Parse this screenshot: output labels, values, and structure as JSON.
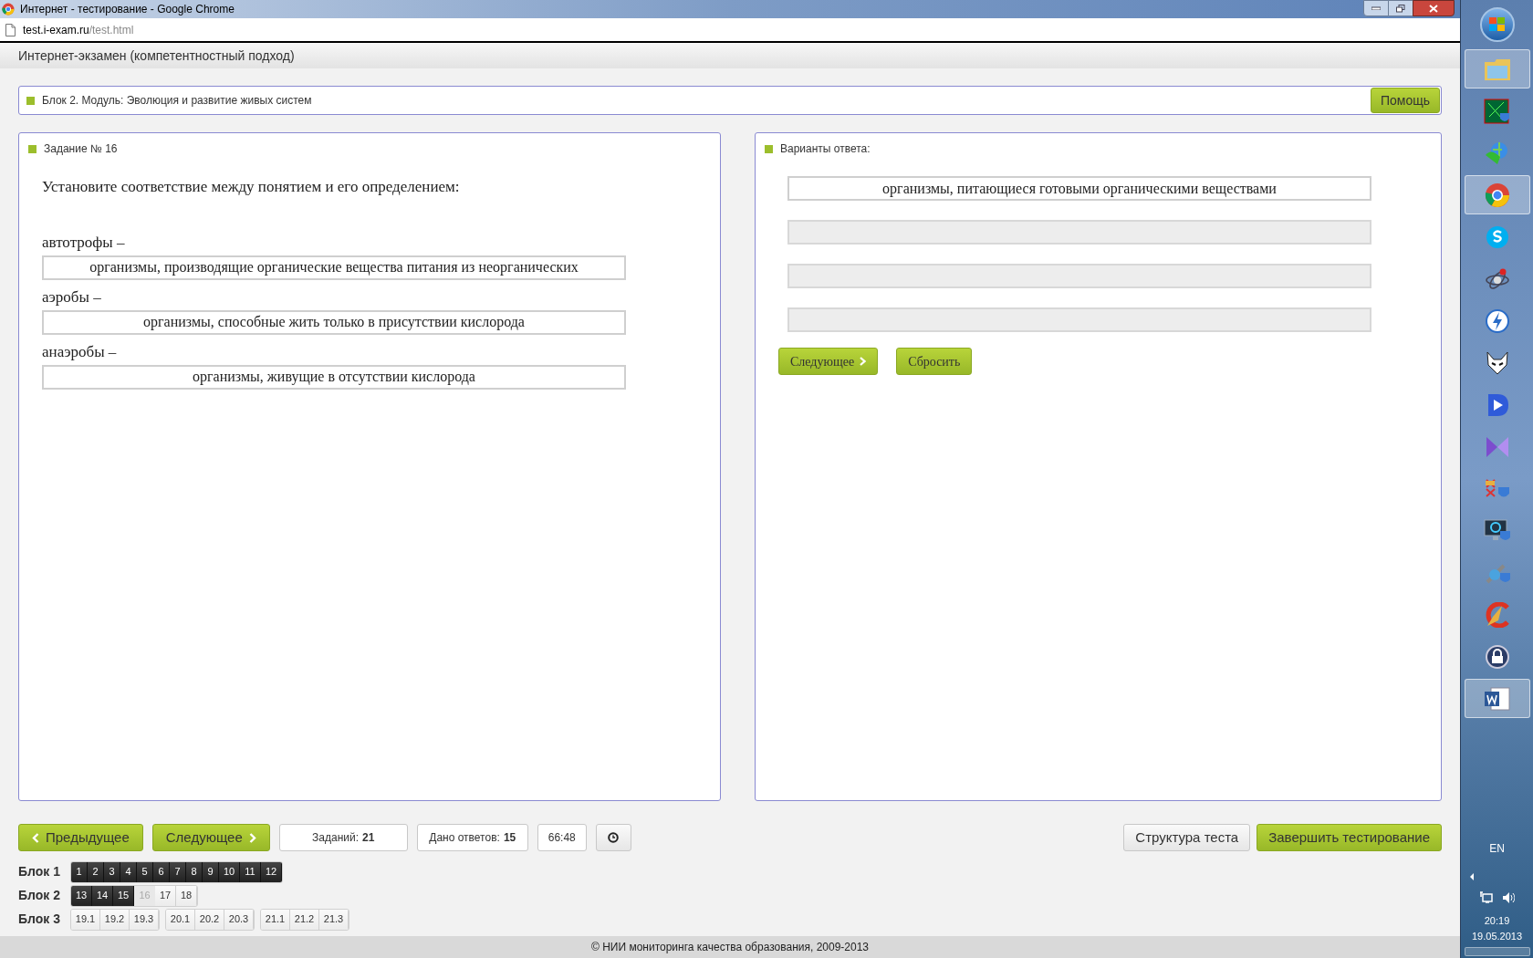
{
  "window": {
    "title": "Интернет - тестирование - Google Chrome"
  },
  "address": {
    "domain": "test.i-exam.ru",
    "path": "/test.html"
  },
  "header": {
    "title": "Интернет-экзамен (компетентностный подход)"
  },
  "module_bar": {
    "label": "Блок 2. Модуль: Эволюция и развитие живых систем",
    "help_button": "Помощь"
  },
  "task_panel": {
    "heading": "Задание № 16",
    "question": "Установите соответствие между понятием и его определением:",
    "pairs": [
      {
        "term": "автотрофы –",
        "answer": "организмы, производящие органические вещества питания из неорганических"
      },
      {
        "term": "аэробы –",
        "answer": "организмы, способные жить только в присутствии кислорода"
      },
      {
        "term": "анаэробы –",
        "answer": "организмы, живущие в отсутствии кислорода"
      }
    ]
  },
  "answers_panel": {
    "heading": "Варианты ответа:",
    "slots": [
      {
        "text": "организмы, питающиеся готовыми органическими веществами",
        "filled": true
      },
      {
        "filled": false
      },
      {
        "filled": false
      },
      {
        "filled": false
      }
    ],
    "next_button": "Следующее",
    "reset_button": "Сбросить"
  },
  "nav": {
    "prev_button": "Предыдущее",
    "next_button": "Следующее",
    "tasks": {
      "label": "Заданий:",
      "value": "21"
    },
    "answered": {
      "label": "Дано ответов:",
      "value": "15"
    },
    "timer": "66:48",
    "structure_button": "Структура теста",
    "finish_button": "Завершить тестирование"
  },
  "blocks": [
    {
      "label": "Блок 1",
      "groups": [
        [
          {
            "label": "1",
            "answered": true,
            "selected": false
          },
          {
            "label": "2",
            "answered": true,
            "selected": false
          },
          {
            "label": "3",
            "answered": true,
            "selected": false
          },
          {
            "label": "4",
            "answered": true,
            "selected": false
          },
          {
            "label": "5",
            "answered": true,
            "selected": false
          },
          {
            "label": "6",
            "answered": true,
            "selected": false
          },
          {
            "label": "7",
            "answered": true,
            "selected": false
          },
          {
            "label": "8",
            "answered": true,
            "selected": false
          },
          {
            "label": "9",
            "answered": true,
            "selected": false
          },
          {
            "label": "10",
            "answered": true,
            "selected": false
          },
          {
            "label": "11",
            "answered": true,
            "selected": false
          },
          {
            "label": "12",
            "answered": true,
            "selected": false
          }
        ]
      ]
    },
    {
      "label": "Блок 2",
      "groups": [
        [
          {
            "label": "13",
            "answered": true,
            "selected": false
          },
          {
            "label": "14",
            "answered": true,
            "selected": false
          },
          {
            "label": "15",
            "answered": true,
            "selected": false
          },
          {
            "label": "16",
            "answered": false,
            "selected": true
          },
          {
            "label": "17",
            "answered": false,
            "selected": false
          },
          {
            "label": "18",
            "answered": false,
            "selected": false
          }
        ]
      ]
    },
    {
      "label": "Блок 3",
      "groups": [
        [
          {
            "label": "19.1",
            "answered": false,
            "selected": false
          },
          {
            "label": "19.2",
            "answered": false,
            "selected": false
          },
          {
            "label": "19.3",
            "answered": false,
            "selected": false
          }
        ],
        [
          {
            "label": "20.1",
            "answered": false,
            "selected": false
          },
          {
            "label": "20.2",
            "answered": false,
            "selected": false
          },
          {
            "label": "20.3",
            "answered": false,
            "selected": false
          }
        ],
        [
          {
            "label": "21.1",
            "answered": false,
            "selected": false
          },
          {
            "label": "21.2",
            "answered": false,
            "selected": false
          },
          {
            "label": "21.3",
            "answered": false,
            "selected": false
          }
        ]
      ]
    }
  ],
  "footer": {
    "text": "© НИИ мониторинга качества образования, 2009-2013"
  },
  "taskbar": {
    "apps": [
      {
        "kind": "folder",
        "active": true
      },
      {
        "kind": "matrix",
        "active": false
      },
      {
        "kind": "download",
        "active": false
      },
      {
        "kind": "chrome",
        "active": true
      },
      {
        "kind": "skype",
        "active": false
      },
      {
        "kind": "atom",
        "active": false
      },
      {
        "kind": "bolt",
        "active": false
      },
      {
        "kind": "fox",
        "active": false
      },
      {
        "kind": "player",
        "active": false
      },
      {
        "kind": "bowtie",
        "active": false
      },
      {
        "kind": "tools",
        "active": false
      },
      {
        "kind": "monitor",
        "active": false
      },
      {
        "kind": "wrench",
        "active": false
      },
      {
        "kind": "broom",
        "active": false
      },
      {
        "kind": "lock",
        "active": false
      },
      {
        "kind": "word",
        "active": true
      }
    ],
    "language": "EN",
    "time": "20:19",
    "date": "19.05.2013"
  }
}
